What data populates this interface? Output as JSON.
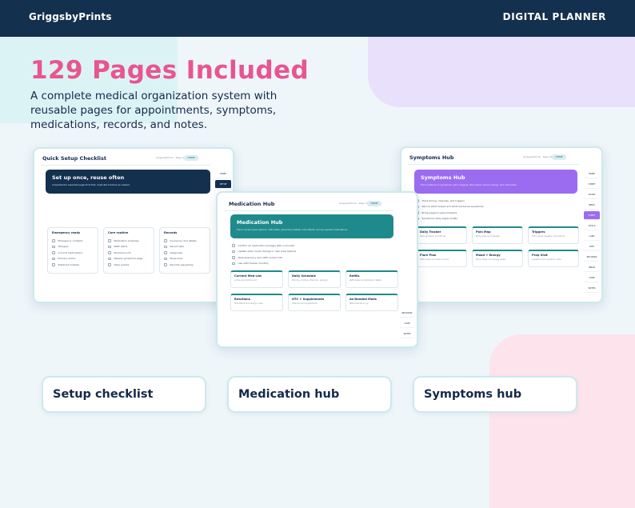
{
  "header": {
    "brand": "GriggsbyPrints",
    "tag": "DIGITAL PLANNER"
  },
  "hero": {
    "title": "129 Pages Included",
    "subtitle": "A complete medical organization system with reusable pages for appointments, symptoms, medications, records, and notes."
  },
  "colors": {
    "navy": "#14304f",
    "pink": "#e8558f",
    "teal": "#1f8a8c",
    "purple": "#9b6cf0"
  },
  "preview_setup": {
    "title": "Quick Setup Checklist",
    "meta": "GriggsbyPrints · Page 6",
    "pill": "HOME",
    "banner_title": "Set up once, reuse often",
    "banner_desc": "Complete the essential pages first then duplicate trackers as needed.",
    "side": [
      "HOME",
      "SETUP"
    ],
    "columns": [
      {
        "title": "Emergency ready",
        "items": [
          "Emergency contacts",
          "Allergies",
          "Current medications",
          "Primary doctor",
          "Preferred hospital"
        ]
      },
      {
        "title": "Care routine",
        "items": [
          "Medication schedule",
          "Refill alerts",
          "Pharmacy info",
          "Weekly symptoms page",
          "Daily events"
        ]
      },
      {
        "title": "Records",
        "items": [
          "Insurance card details",
          "Recent labs",
          "Diagnoses",
          "Physicians",
          "Records requesting"
        ]
      }
    ]
  },
  "preview_meds": {
    "title": "Medication Hub",
    "meta": "GriggsbyPrints · Page 42",
    "pill": "HOME",
    "banner_title": "Medication Hub",
    "banner_desc": "Track current prescriptions, refill dates, pharmacy details, side effects, and as-needed medications.",
    "checks": [
      "Confirm all medication dosages with a provider",
      "Update when meds change or new prescriptions",
      "Note pharmacy and refill contact info",
      "Use refill tracker monthly"
    ],
    "cards": [
      {
        "title": "Current Med List",
        "desc": "Active prescriptions list"
      },
      {
        "title": "Daily Schedule",
        "desc": "Morning, midday, afternoon, evening"
      },
      {
        "title": "Refills",
        "desc": "Refill dates and pharmacy details"
      },
      {
        "title": "Reactions",
        "desc": "Side effects and allergy notes"
      },
      {
        "title": "OTC + Supplements",
        "desc": "Vitamins and supplements"
      },
      {
        "title": "As-Needed Meds",
        "desc": "PRN medication log"
      }
    ],
    "side": [
      "RECORDS",
      "CARE",
      "NOTES"
    ]
  },
  "preview_symptoms": {
    "title": "Symptoms Hub",
    "meta": "GriggsbyPrints · Page 66",
    "pill": "HOME",
    "banner_title": "Symptoms Hub",
    "banner_desc": "Track patterns in symptoms, pain, triggers, flare plans, mood, energy, and visit notes.",
    "checks": [
      "Track timing, intensity, and triggers",
      "Record what helped and what worsened symptoms",
      "Bring pages to appointments",
      "Symptoms daily pages briefly"
    ],
    "cards": [
      {
        "title": "Daily Tracker",
        "desc": "Daily symptom monitoring"
      },
      {
        "title": "Pain Map",
        "desc": "Body areas and intensity"
      },
      {
        "title": "Triggers",
        "desc": "Food, stress, weather, and activity"
      },
      {
        "title": "Flare Plan",
        "desc": "What helps and what to avoid"
      },
      {
        "title": "Mood + Energy",
        "desc": "Mood, sleep, and energy levels"
      },
      {
        "title": "Prep Visit",
        "desc": "Questions and symptom notes"
      }
    ],
    "side": [
      "HOME",
      "SYMPT",
      "CHART",
      "MEDS",
      "SYMPT",
      "VITALS",
      "LABS",
      "DIET",
      "RECORDS",
      "INSUR",
      "CARE",
      "NOTES"
    ]
  },
  "labels": [
    "Setup checklist",
    "Medication hub",
    "Symptoms hub"
  ]
}
